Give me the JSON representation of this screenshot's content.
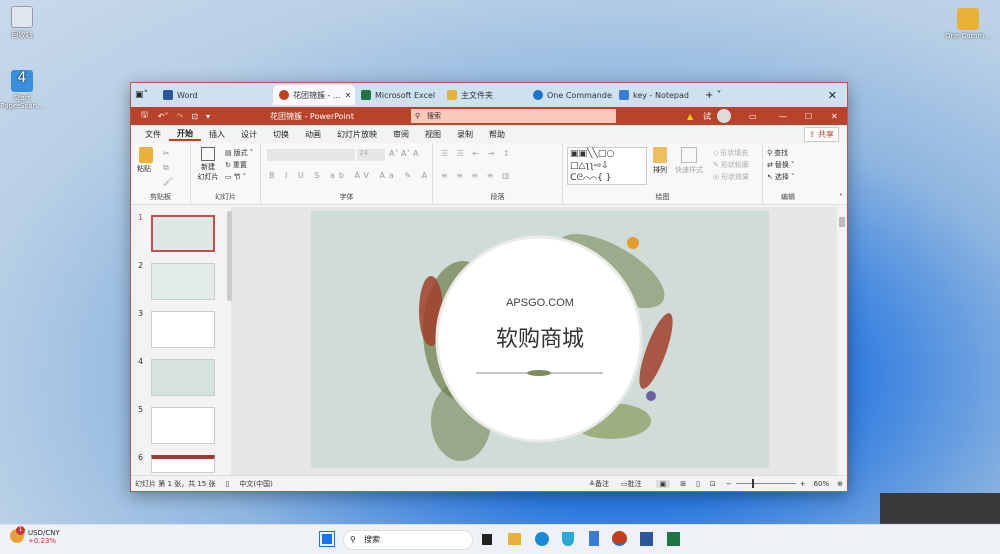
{
  "desktop": {
    "icons": [
      {
        "label": "回收站"
      },
      {
        "label": "Start PaperScan..."
      },
      {
        "label": "One Comm..."
      }
    ]
  },
  "browser_tabs": [
    {
      "label": "Word",
      "color": "#2b579a"
    },
    {
      "label": "花团锦簇 - ...",
      "color": "#c43e1c",
      "active": true
    },
    {
      "label": "Microsoft Excel",
      "color": "#217346"
    },
    {
      "label": "主文件夹",
      "color": "#e8b23a"
    },
    {
      "label": "One Commande...",
      "color": "#1a73c8"
    },
    {
      "label": "key - Notepad",
      "color": "#3a7bd5"
    }
  ],
  "titlebar": {
    "title": "花团锦簇 - PowerPoint",
    "search_placeholder": "搜索",
    "user": "试"
  },
  "menu": [
    "文件",
    "开始",
    "插入",
    "设计",
    "切换",
    "动画",
    "幻灯片放映",
    "审阅",
    "视图",
    "录制",
    "帮助"
  ],
  "share": "共享",
  "ribbon": {
    "clipboard": {
      "label": "剪贴板",
      "paste": "粘贴"
    },
    "slides": {
      "label": "幻灯片",
      "new_slide": "新建\n幻灯片",
      "layout": "版式",
      "reset": "重置",
      "section": "节"
    },
    "font": {
      "label": "字体",
      "size": "24"
    },
    "paragraph": {
      "label": "段落"
    },
    "drawing": {
      "label": "绘图",
      "arrange": "排列",
      "quick_styles": "快速样式",
      "fill": "形状填充",
      "outline": "形状轮廓",
      "effects": "形状效果"
    },
    "editing": {
      "label": "编辑",
      "find": "查找",
      "replace": "替换",
      "select": "选择"
    }
  },
  "thumbnails": [
    "1",
    "2",
    "3",
    "4",
    "5",
    "6"
  ],
  "slide": {
    "subtitle": "APSGO.COM",
    "title": "软购商城"
  },
  "status": {
    "slide_info": "幻灯片 第 1 张，共 15 张",
    "language": "中文(中国)",
    "notes": "备注",
    "comments": "批注",
    "zoom": "60%",
    "zoom_value": 60
  },
  "taskbar": {
    "stock": "USD/CNY",
    "change": "+0.23%",
    "badge": "1",
    "search": "搜索"
  }
}
